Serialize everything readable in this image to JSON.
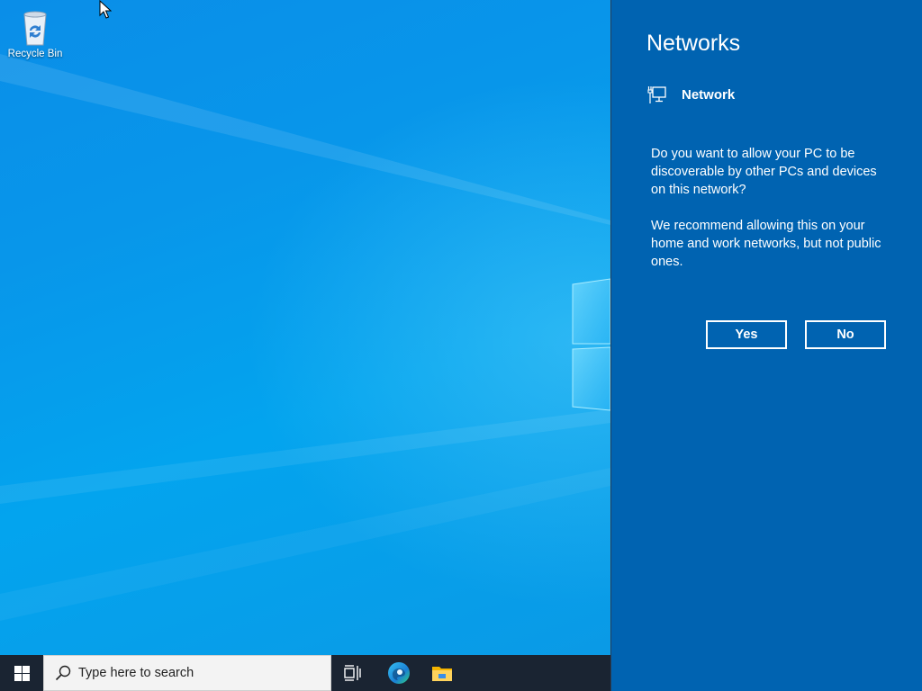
{
  "desktop": {
    "icons": [
      {
        "label": "Recycle Bin",
        "icon": "recycle-bin-icon"
      }
    ]
  },
  "taskbar": {
    "start_icon": "windows-logo-icon",
    "search": {
      "placeholder": "Type here to search",
      "value": "",
      "icon": "search-icon"
    },
    "buttons": [
      {
        "name": "task-view",
        "icon": "task-view-icon"
      },
      {
        "name": "edge",
        "icon": "edge-browser-icon"
      },
      {
        "name": "file-explorer",
        "icon": "folder-icon"
      }
    ]
  },
  "flyout": {
    "title": "Networks",
    "network": {
      "name": "Network",
      "icon": "ethernet-monitor-icon"
    },
    "question": "Do you want to allow your PC to be discoverable by other PCs and devices on this network?",
    "recommendation": "We recommend allowing this on your home and work networks, but not public ones.",
    "yes_label": "Yes",
    "no_label": "No"
  },
  "colors": {
    "flyout_bg": "#0063b1",
    "taskbar_bg": "#1a2432",
    "desktop_blue": "#0896ea",
    "text": "#ffffff"
  }
}
